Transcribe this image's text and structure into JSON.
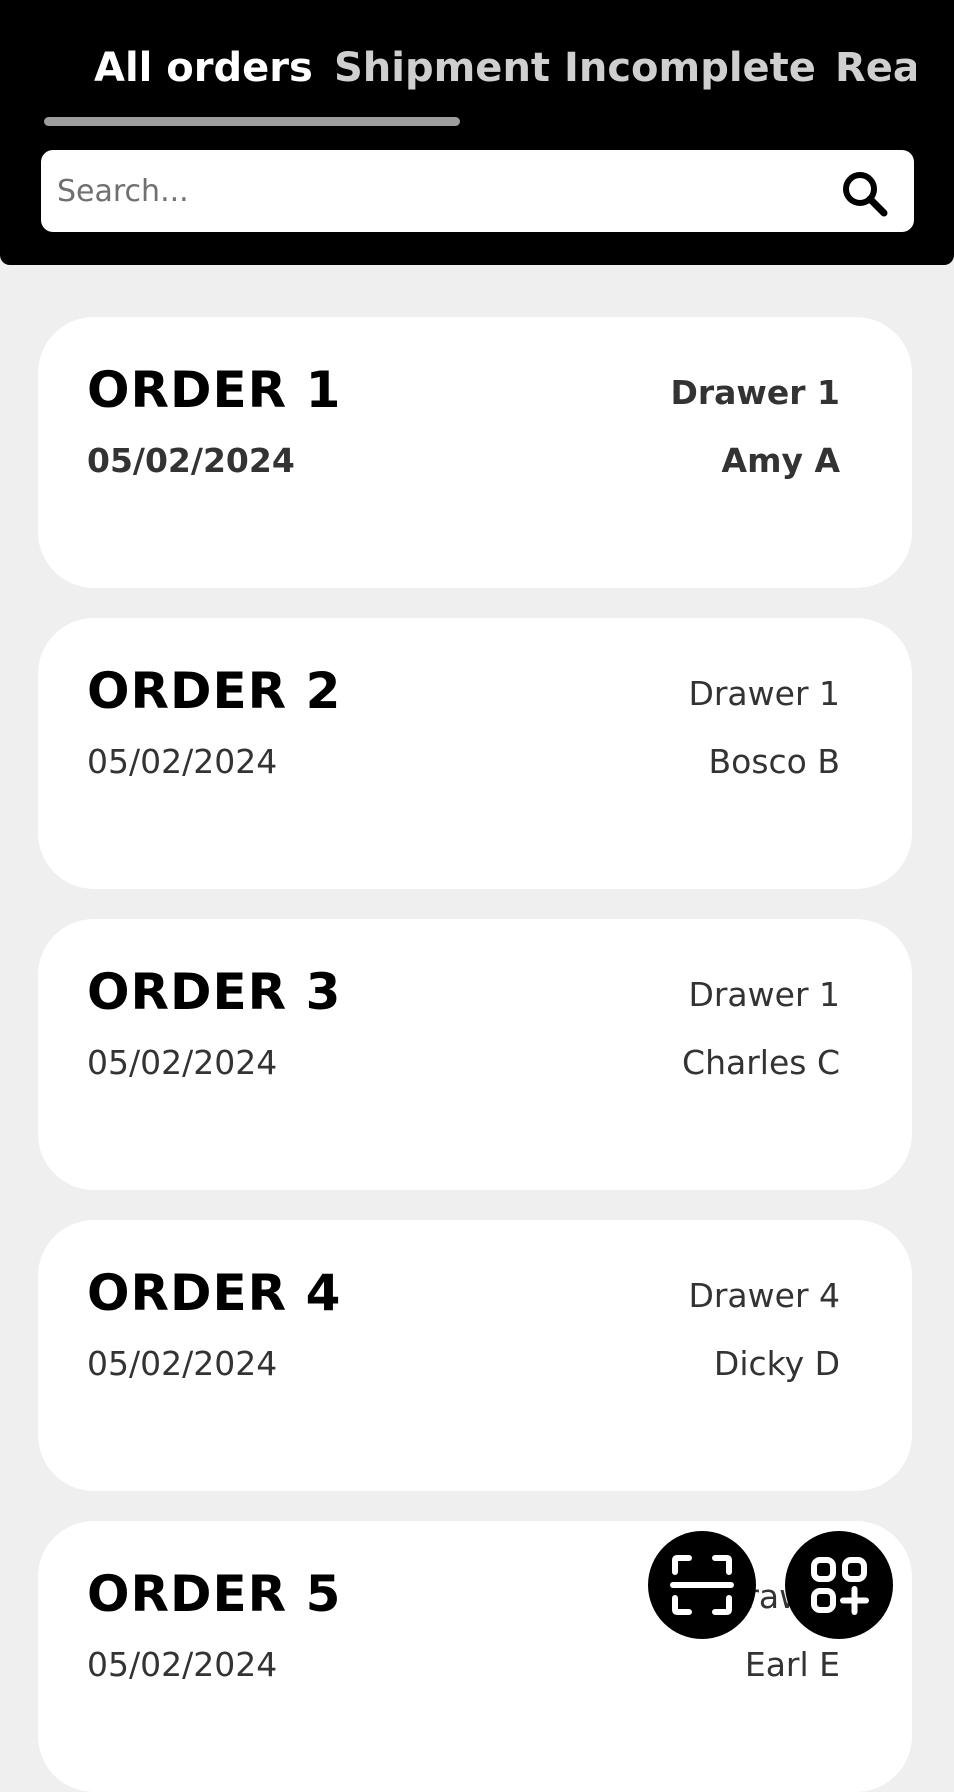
{
  "tabs": [
    {
      "label": "All orders",
      "active": true
    },
    {
      "label": "Shipment Incomplete",
      "active": false
    },
    {
      "label": "Ready",
      "active": false
    }
  ],
  "search": {
    "placeholder": "Search...",
    "icon": "search-icon"
  },
  "orders": [
    {
      "title": "ORDER 1",
      "date": "05/02/2024",
      "drawer": "Drawer 1",
      "name": "Amy A"
    },
    {
      "title": "ORDER 2",
      "date": "05/02/2024",
      "drawer": "Drawer 1",
      "name": "Bosco B"
    },
    {
      "title": "ORDER 3",
      "date": "05/02/2024",
      "drawer": "Drawer 1",
      "name": "Charles C"
    },
    {
      "title": "ORDER 4",
      "date": "05/02/2024",
      "drawer": "Drawer 4",
      "name": "Dicky D"
    },
    {
      "title": "ORDER 5",
      "date": "05/02/2024",
      "drawer": "Drawer",
      "name": "Earl E"
    }
  ],
  "actions": {
    "scan_icon": "scan-icon",
    "add_icon": "qr-add-icon"
  },
  "colors": {
    "header_bg": "#000000",
    "page_bg": "#efefef",
    "card_bg": "#ffffff",
    "tab_indicator": "#9e9e9e"
  }
}
